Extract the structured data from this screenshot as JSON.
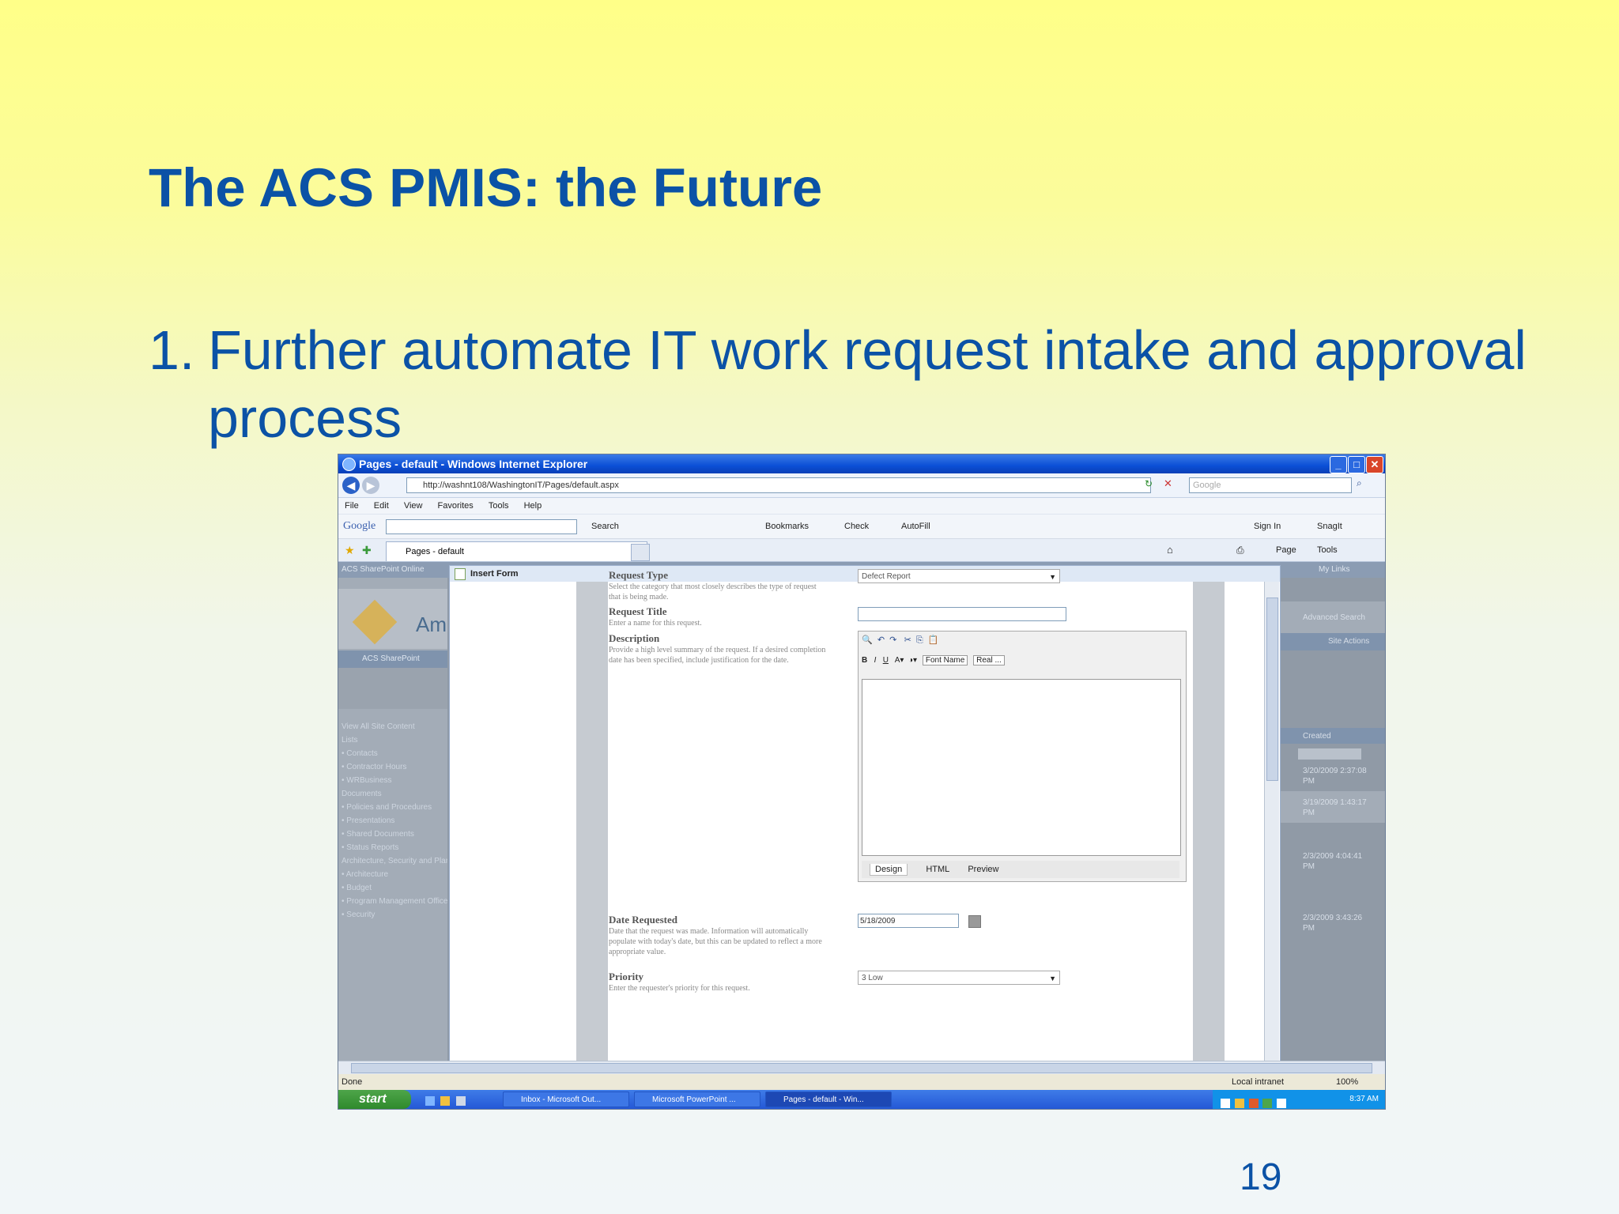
{
  "slide": {
    "title": "The ACS PMIS: the Future",
    "bullet_number": "1.",
    "bullet_line1": "Further automate IT work request intake and approval",
    "bullet_line2": "process",
    "page_number": "19"
  },
  "browser": {
    "window_title": "Pages - default - Windows Internet Explorer",
    "address": "http://washnt108/WashingtonIT/Pages/default.aspx",
    "search_placeholder": "Google",
    "menu": [
      "File",
      "Edit",
      "View",
      "Favorites",
      "Tools",
      "Help"
    ],
    "google_label": "Google",
    "google_tools": [
      "Search",
      "Bookmarks",
      "Check",
      "AutoFill"
    ],
    "google_right": [
      "Sign In",
      "SnagIt"
    ],
    "tab_label": "Pages - default",
    "tab_tools": [
      "Page",
      "Tools"
    ],
    "status_left": "Done",
    "status_zone": "Local intranet",
    "status_zoom": "100%"
  },
  "sharepoint": {
    "ribbon_label": "ACS SharePoint Online",
    "my_links": "My Links",
    "logo_text": "Am",
    "nav_bar": "ACS SharePoint",
    "quick_launch": [
      "View All Site Content",
      "Lists",
      "• Contacts",
      "• Contractor Hours",
      "• WRBusiness",
      "Documents",
      "• Policies and Procedures",
      "• Presentations",
      "• Shared Documents",
      "• Status Reports",
      "Architecture, Security and Planning",
      "• Architecture",
      "• Budget",
      "• Program Management Office",
      "• Security"
    ],
    "right_panel": {
      "search": "Advanced Search",
      "site_action": "Site Actions",
      "created": "Created",
      "dates": [
        "3/20/2009 2:37:08 PM",
        "3/19/2009 1:43:17 PM",
        "2/3/2009 4:04:41 PM",
        "2/3/2009 3:43:26 PM"
      ]
    }
  },
  "form": {
    "title": "Insert Form",
    "request_type_label": "Request Type",
    "request_type_desc": "Select the category that most closely describes the type of request that is being made.",
    "request_type_value": "Defect Report",
    "request_title_label": "Request Title",
    "request_title_desc": "Enter a name for this request.",
    "description_label": "Description",
    "description_desc": "Provide a high level summary of the request. If a desired completion date has been specified, include justification for the date.",
    "rte_font": "Font Name",
    "rte_size": "Real ...",
    "rte_tabs": [
      "Design",
      "HTML",
      "Preview"
    ],
    "date_label": "Date Requested",
    "date_desc": "Date that the request was made. Information will automatically populate with today's date, but this can be updated to reflect a more appropriate value.",
    "date_value": "5/18/2009",
    "priority_label": "Priority",
    "priority_desc": "Enter the requester's priority for this request.",
    "priority_value": "3 Low"
  },
  "taskbar": {
    "start": "start",
    "items": [
      "Inbox - Microsoft Out...",
      "Microsoft PowerPoint ...",
      "Pages - default - Win..."
    ],
    "clock": "8:37 AM"
  },
  "colors": {
    "title_blue": "#0b52a6",
    "xp_blue": "#0b4fd6",
    "start_green": "#2f8a2c"
  }
}
